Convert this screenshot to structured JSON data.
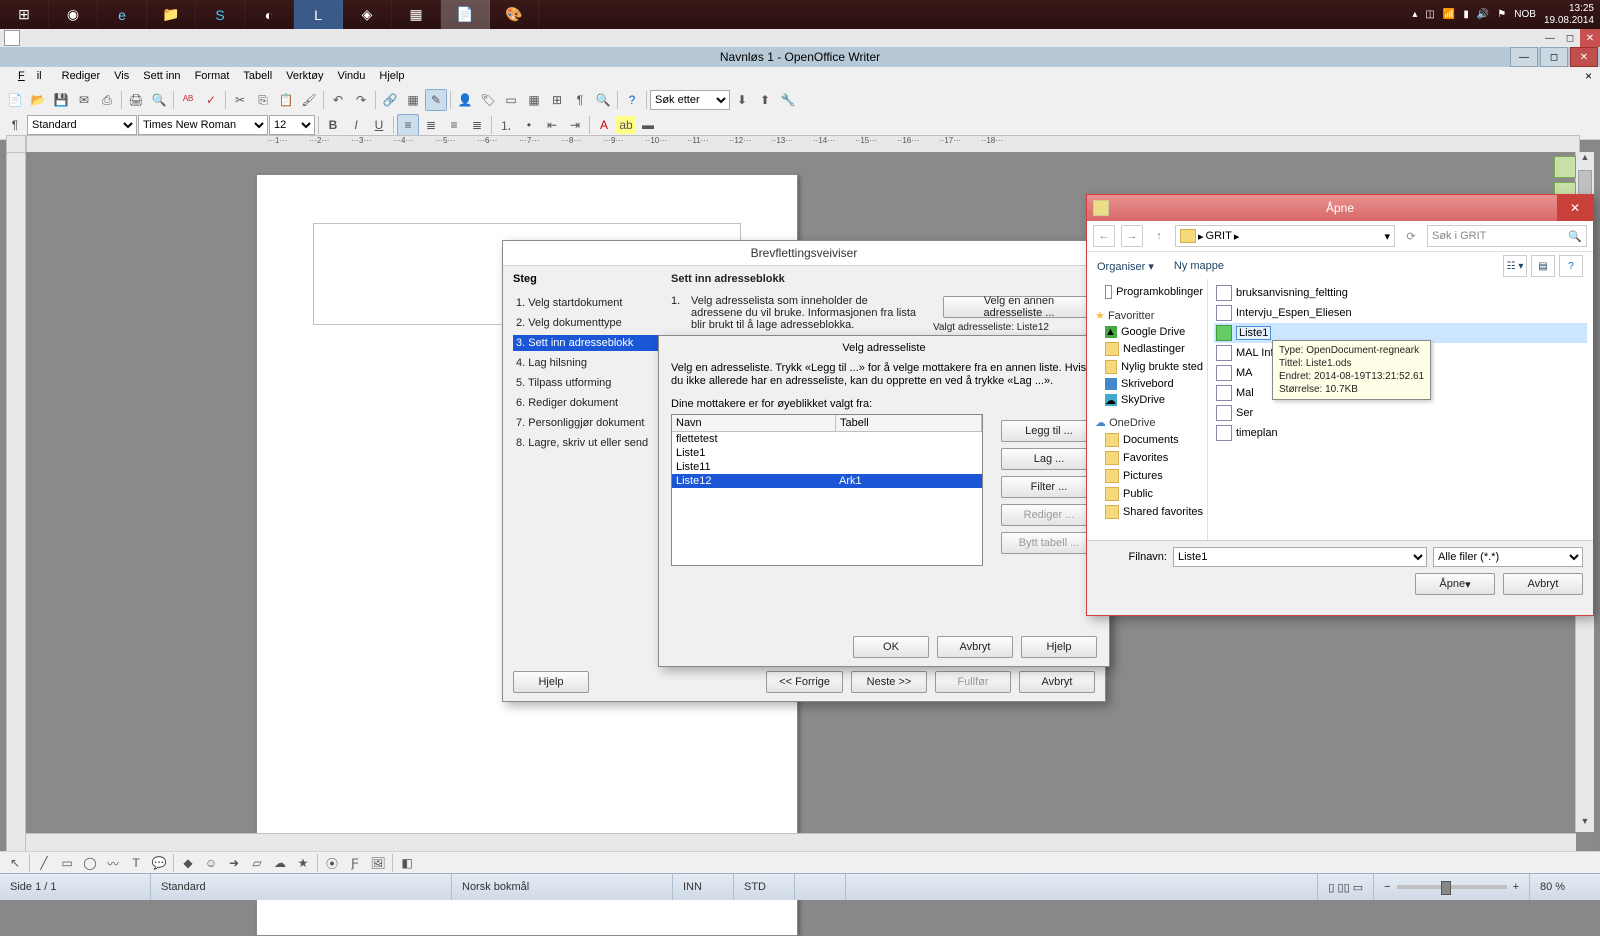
{
  "taskbar": {
    "tray_lang": "NOB",
    "clock_time": "13:25",
    "clock_date": "19.08.2014"
  },
  "app": {
    "title": "Navnløs 1 - OpenOffice Writer"
  },
  "menu": {
    "fil": "Fil",
    "rediger": "Rediger",
    "vis": "Vis",
    "sett_inn": "Sett inn",
    "format": "Format",
    "tabell": "Tabell",
    "verktoy": "Verktøy",
    "vindu": "Vindu",
    "hjelp": "Hjelp"
  },
  "toolbar": {
    "search_placeholder": "Søk etter",
    "style": "Standard",
    "font": "Times New Roman",
    "size": "12"
  },
  "ruler": [
    "1",
    "2",
    "3",
    "4",
    "5",
    "6",
    "7",
    "8",
    "9",
    "10",
    "11",
    "12",
    "13",
    "14",
    "15",
    "16",
    "17",
    "18"
  ],
  "wizard": {
    "title": "Brevflettingsveiviser",
    "steps_heading": "Steg",
    "steps": [
      "1. Velg startdokument",
      "2. Velg dokumenttype",
      "3. Sett inn adresseblokk",
      "4. Lag hilsning",
      "5. Tilpass utforming",
      "6. Rediger dokument",
      "7. Personliggjør dokument",
      "8. Lagre, skriv ut eller send"
    ],
    "content_heading": "Sett inn adresseblokk",
    "step1_num": "1.",
    "step1_text": "Velg adresselista som inneholder de adressene du vil bruke. Informasjonen fra lista blir brukt til å lage adresseblokka.",
    "select_other_btn": "Velg en annen adresseliste ...",
    "selected_label": "Valgt adresseliste: Liste12",
    "help": "Hjelp",
    "back": "<< Forrige",
    "next": "Neste >>",
    "finish": "Fullfør",
    "cancel": "Avbryt"
  },
  "subdialog": {
    "title": "Velg adresseliste",
    "instr": "Velg en adresseliste. Trykk «Legg til ...» for å velge mottakere fra en annen liste. Hvis du ikke allerede har en adresseliste, kan du opprette en ved å trykke «Lag ...».",
    "recipients_label": "Dine mottakere er for øyeblikket valgt fra:",
    "col_name": "Navn",
    "col_table": "Tabell",
    "rows": [
      {
        "name": "flettetest",
        "table": ""
      },
      {
        "name": "Liste1",
        "table": ""
      },
      {
        "name": "Liste11",
        "table": ""
      },
      {
        "name": "Liste12",
        "table": "Ark1"
      }
    ],
    "btn_add": "Legg til ...",
    "btn_create": "Lag ...",
    "btn_filter": "Filter ...",
    "btn_edit": "Rediger ...",
    "btn_swap": "Bytt tabell ...",
    "ok": "OK",
    "cancel": "Avbryt",
    "help": "Hjelp"
  },
  "filedialog": {
    "title": "Åpne",
    "crumb_folder": "GRIT",
    "search_placeholder": "Søk i GRIT",
    "organize": "Organiser",
    "new_folder": "Ny mappe",
    "tree": {
      "programkoblinger": "Programkoblinger",
      "favoritter": "Favoritter",
      "google_drive": "Google Drive",
      "nedlastinger": "Nedlastinger",
      "nylig": "Nylig brukte sted",
      "skrivebord": "Skrivebord",
      "skydrive": "SkyDrive",
      "onedrive": "OneDrive",
      "documents": "Documents",
      "favorites": "Favorites",
      "pictures": "Pictures",
      "public": "Public",
      "shared": "Shared favorites"
    },
    "files": [
      "bruksanvisning_feltting",
      "Intervju_Espen_Eliesen",
      "Liste1",
      "MAL Info",
      "MA",
      "Mal",
      "Ser",
      "timeplan"
    ],
    "filename_label": "Filnavn:",
    "filename_value": "Liste1",
    "filter": "Alle filer (*.*)",
    "open": "Åpne",
    "cancel": "Avbryt"
  },
  "tooltip": {
    "l1": "Type: OpenDocument-regneark",
    "l2": "Tittel: Liste1.ods",
    "l3": "Endret: 2014-08-19T13:21:52.61",
    "l4": "Størrelse: 10.7KB"
  },
  "status": {
    "page": "Side 1 / 1",
    "style": "Standard",
    "lang": "Norsk bokmål",
    "ins": "INN",
    "std": "STD",
    "zoom": "80 %"
  }
}
